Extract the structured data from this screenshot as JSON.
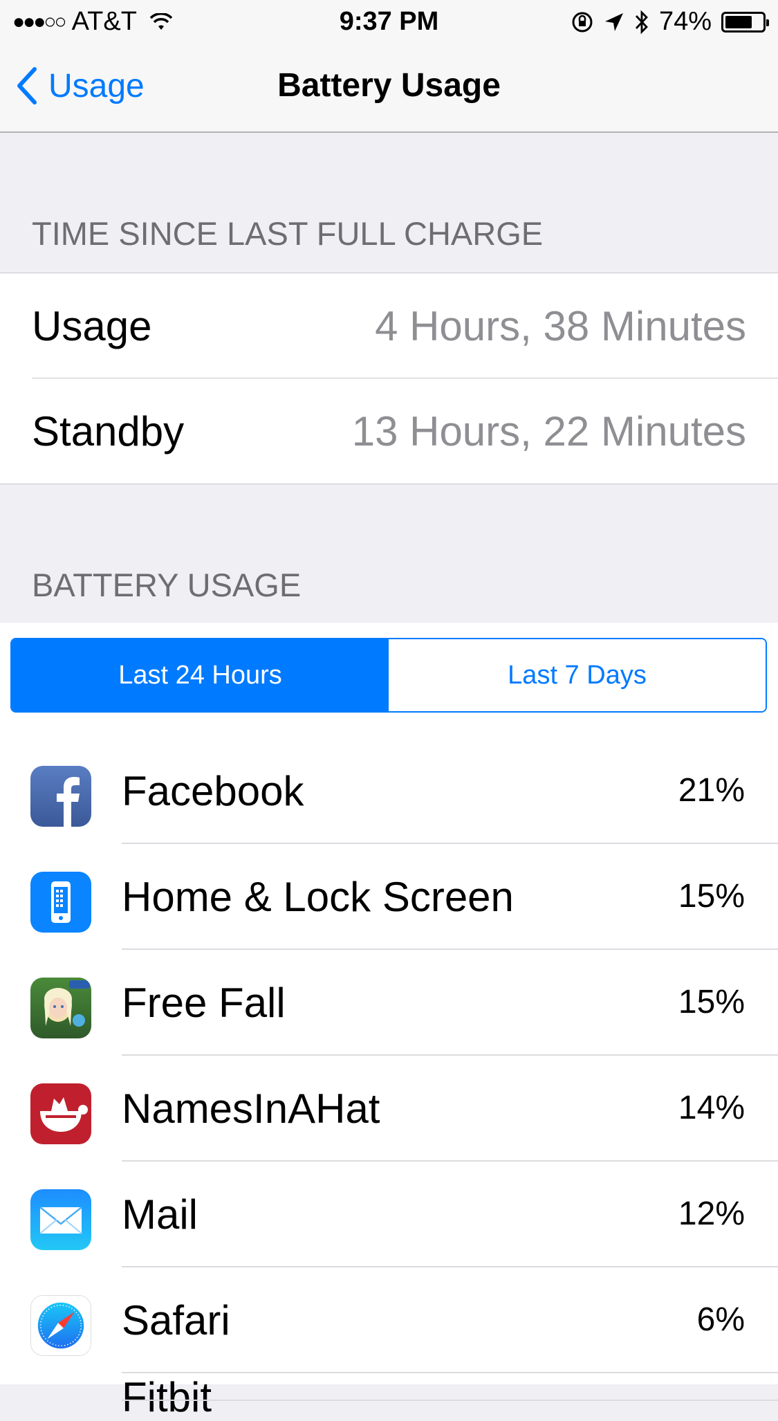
{
  "status_bar": {
    "signal_dots": "●●●○○",
    "carrier": "AT&T",
    "time": "9:37 PM",
    "battery_percent": "74%",
    "battery_level": 0.74,
    "icons": [
      "wifi-icon",
      "rotation-lock-icon",
      "location-icon",
      "bluetooth-icon",
      "battery-icon"
    ]
  },
  "nav": {
    "back_label": "Usage",
    "title": "Battery Usage"
  },
  "time_since_charge": {
    "header": "TIME SINCE LAST FULL CHARGE",
    "rows": [
      {
        "label": "Usage",
        "value": "4 Hours, 38 Minutes"
      },
      {
        "label": "Standby",
        "value": "13 Hours, 22 Minutes"
      }
    ]
  },
  "battery_usage": {
    "header": "BATTERY USAGE",
    "segments": [
      "Last 24 Hours",
      "Last 7 Days"
    ],
    "selected_segment": "Last 24 Hours",
    "apps": [
      {
        "name": "Facebook",
        "percent": "21%",
        "icon": "facebook-icon"
      },
      {
        "name": "Home & Lock Screen",
        "percent": "15%",
        "icon": "home-lock-screen-icon"
      },
      {
        "name": "Free Fall",
        "percent": "15%",
        "icon": "free-fall-icon"
      },
      {
        "name": "NamesInAHat",
        "percent": "14%",
        "icon": "namesinahat-icon"
      },
      {
        "name": "Mail",
        "percent": "12%",
        "icon": "mail-icon"
      },
      {
        "name": "Safari",
        "percent": "6%",
        "icon": "safari-icon"
      }
    ],
    "partial_next": "Fitbit"
  },
  "colors": {
    "accent": "#007aff",
    "background": "#efeff4",
    "secondary_text": "#8e8e93"
  }
}
